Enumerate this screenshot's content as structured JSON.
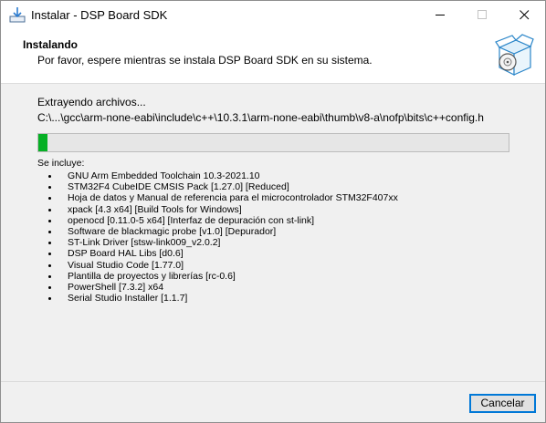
{
  "window": {
    "title": "Instalar - DSP Board SDK"
  },
  "titlebar": {
    "icons": [
      "installer-icon",
      "minimize-icon",
      "maximize-icon",
      "close-icon"
    ]
  },
  "header": {
    "title": "Instalando",
    "subtitle": "Por favor, espere mientras se instala DSP Board SDK en su sistema.",
    "icon": "install-box-icon"
  },
  "status": {
    "label": "Extrayendo archivos...",
    "path": "C:\\...\\gcc\\arm-none-eabi\\include\\c++\\10.3.1\\arm-none-eabi\\thumb\\v8-a\\nofp\\bits\\c++config.h"
  },
  "progress": {
    "fraction": 0.02,
    "color": "#06b025"
  },
  "includes": {
    "title": "Se incluye:",
    "items": [
      "GNU Arm Embedded Toolchain 10.3-2021.10",
      "STM32F4 CubeIDE CMSIS Pack [1.27.0] [Reduced]",
      "Hoja de datos y Manual de referencia para el microcontrolador STM32F407xx",
      "xpack [4.3 x64] [Build Tools for Windows]",
      "openocd [0.11.0-5 x64] [Interfaz de depuración con st-link]",
      "Software de blackmagic probe [v1.0] [Depurador]",
      "ST-Link Driver [stsw-link009_v2.0.2]",
      "DSP Board HAL Libs [d0.6]",
      "Visual Studio Code [1.77.0]",
      "Plantilla de proyectos y librerías [rc-0.6]",
      "PowerShell [7.3.2] x64",
      "Serial Studio Installer [1.1.7]"
    ]
  },
  "footer": {
    "cancel_label": "Cancelar",
    "accent": "#0078d7"
  }
}
